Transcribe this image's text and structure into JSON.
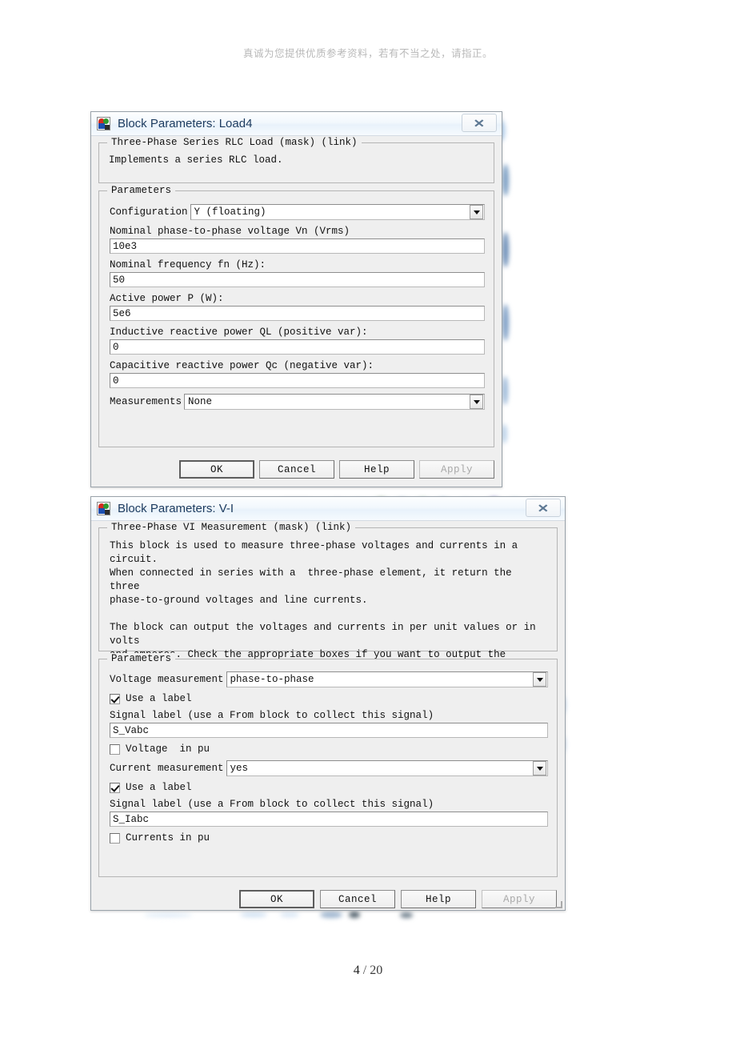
{
  "page": {
    "header_note": "真诚为您提供优质参考资料，若有不当之处，请指正。",
    "footer_current": "4",
    "footer_sep": "/",
    "footer_total": "20"
  },
  "dialog_load4": {
    "title": "Block Parameters: Load4",
    "close_glyph": "✕",
    "mask_group": {
      "legend": "Three-Phase Series RLC Load (mask) (link)",
      "description": "Implements a series RLC load."
    },
    "parameters_group": {
      "legend": "Parameters",
      "configuration": {
        "label": "Configuration",
        "value": "Y (floating)"
      },
      "nominal_voltage": {
        "label": "Nominal phase-to-phase voltage Vn (Vrms)",
        "value": "10e3"
      },
      "nominal_frequency": {
        "label": "Nominal frequency fn (Hz):",
        "value": "50"
      },
      "active_power": {
        "label": "Active power P (W):",
        "value": "5e6"
      },
      "inductive_power": {
        "label": "Inductive reactive power QL (positive var):",
        "value": "0"
      },
      "capacitive_power": {
        "label": "Capacitive reactive power Qc (negative var):",
        "value": "0"
      },
      "measurements": {
        "label": "Measurements",
        "value": "None"
      }
    },
    "buttons": {
      "ok": "OK",
      "cancel": "Cancel",
      "help": "Help",
      "apply": "Apply"
    }
  },
  "dialog_vi": {
    "title": "Block Parameters: V-I",
    "close_glyph": "✕",
    "mask_group": {
      "legend": "Three-Phase VI Measurement (mask) (link)",
      "description": "This block is used to measure three-phase voltages and currents in a circuit.\nWhen connected in series with a  three-phase element, it return the three\nphase-to-ground voltages and line currents.\n\nThe block can output the voltages and currents in per unit values or in volts\nand amperes. Check the appropriate boxes if you want to output the voltages and\ncurrents  in pu"
    },
    "parameters_group": {
      "legend": "Parameters",
      "voltage_measurement": {
        "label": "Voltage measurement",
        "value": "phase-to-phase"
      },
      "voltage_use_label": {
        "label": "Use a label",
        "checked": true
      },
      "voltage_signal_label": {
        "label": "Signal label  (use a From block to collect this signal)",
        "value": "S_Vabc"
      },
      "voltage_in_pu": {
        "label": "Voltage  in pu",
        "checked": false
      },
      "current_measurement": {
        "label": "Current measurement",
        "value": "yes"
      },
      "current_use_label": {
        "label": "Use a label",
        "checked": true
      },
      "current_signal_label": {
        "label": "Signal label  (use a From block to collect this signal)",
        "value": "S_Iabc"
      },
      "currents_in_pu": {
        "label": "Currents in pu",
        "checked": false
      }
    },
    "buttons": {
      "ok": "OK",
      "cancel": "Cancel",
      "help": "Help",
      "apply": "Apply"
    }
  }
}
